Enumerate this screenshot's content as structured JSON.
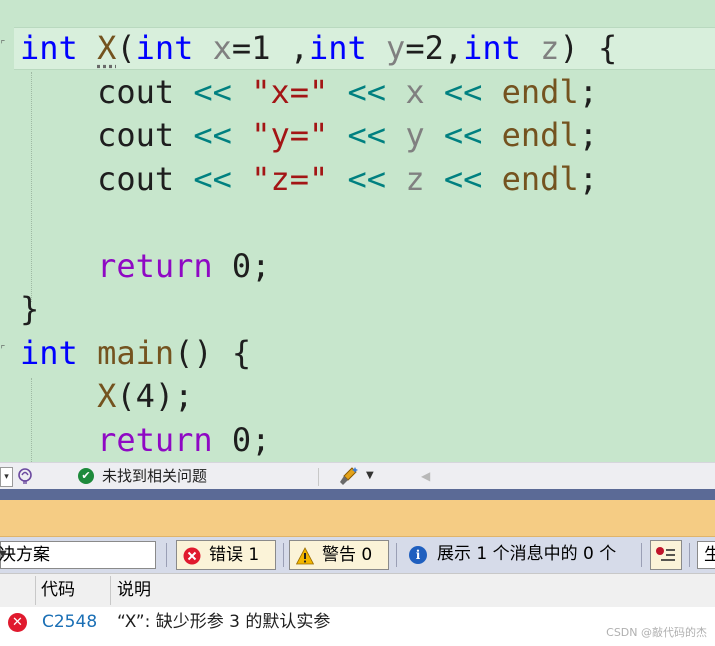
{
  "code": {
    "lines": [
      [
        [
          "int",
          "kw"
        ],
        [
          " ",
          ""
        ],
        [
          "X",
          "fn sq"
        ],
        [
          "(",
          ""
        ],
        [
          "int",
          "kw"
        ],
        [
          " ",
          ""
        ],
        [
          "x",
          "prm"
        ],
        [
          "=1 ,",
          ""
        ],
        [
          "int",
          "kw"
        ],
        [
          " ",
          ""
        ],
        [
          "y",
          "prm"
        ],
        [
          "=2,",
          ""
        ],
        [
          "int",
          "kw"
        ],
        [
          " ",
          ""
        ],
        [
          "z",
          "prm"
        ],
        [
          ") {",
          ""
        ]
      ],
      [
        [
          "    ",
          ""
        ],
        [
          "cout",
          ""
        ],
        [
          " ",
          ""
        ],
        [
          "<<",
          "op"
        ],
        [
          " ",
          ""
        ],
        [
          "\"x=\"",
          "str"
        ],
        [
          " ",
          ""
        ],
        [
          "<<",
          "op"
        ],
        [
          " ",
          ""
        ],
        [
          "x",
          "prm"
        ],
        [
          " ",
          ""
        ],
        [
          "<<",
          "op"
        ],
        [
          " ",
          ""
        ],
        [
          "endl",
          "fn"
        ],
        [
          ";",
          ""
        ]
      ],
      [
        [
          "    ",
          ""
        ],
        [
          "cout",
          ""
        ],
        [
          " ",
          ""
        ],
        [
          "<<",
          "op"
        ],
        [
          " ",
          ""
        ],
        [
          "\"y=\"",
          "str"
        ],
        [
          " ",
          ""
        ],
        [
          "<<",
          "op"
        ],
        [
          " ",
          ""
        ],
        [
          "y",
          "prm"
        ],
        [
          " ",
          ""
        ],
        [
          "<<",
          "op"
        ],
        [
          " ",
          ""
        ],
        [
          "endl",
          "fn"
        ],
        [
          ";",
          ""
        ]
      ],
      [
        [
          "    ",
          ""
        ],
        [
          "cout",
          ""
        ],
        [
          " ",
          ""
        ],
        [
          "<<",
          "op"
        ],
        [
          " ",
          ""
        ],
        [
          "\"z=\"",
          "str"
        ],
        [
          " ",
          ""
        ],
        [
          "<<",
          "op"
        ],
        [
          " ",
          ""
        ],
        [
          "z",
          "prm"
        ],
        [
          " ",
          ""
        ],
        [
          "<<",
          "op"
        ],
        [
          " ",
          ""
        ],
        [
          "endl",
          "fn"
        ],
        [
          ";",
          ""
        ]
      ],
      [],
      [
        [
          "    ",
          ""
        ],
        [
          "return",
          "ret"
        ],
        [
          " 0;",
          ""
        ]
      ],
      [
        [
          "}",
          ""
        ]
      ],
      [
        [
          "int",
          "kw"
        ],
        [
          " ",
          ""
        ],
        [
          "main",
          "fn"
        ],
        [
          "() {",
          ""
        ]
      ],
      [
        [
          "    ",
          ""
        ],
        [
          "X",
          "fn"
        ],
        [
          "(4);",
          ""
        ]
      ],
      [
        [
          "    ",
          ""
        ],
        [
          "return",
          "ret"
        ],
        [
          " 0;",
          ""
        ]
      ]
    ]
  },
  "status": {
    "no_issues": "未找到相关问题"
  },
  "error_list": {
    "scope": "决方案",
    "errors_label": "错误 1",
    "warnings_label": "警告 0",
    "messages_label": "展示 1 个消息中的 0 个",
    "search_partial": "生",
    "columns": {
      "code": "代码",
      "description": "说明"
    },
    "rows": [
      {
        "code": "C2548",
        "description": "“X”: 缺少形参 3 的默认实参"
      }
    ]
  },
  "watermark": "CSDN @敲代码的杰"
}
